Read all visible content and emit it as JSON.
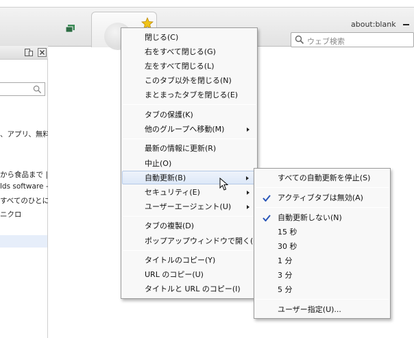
{
  "window": {
    "title": "about:blank"
  },
  "search": {
    "placeholder": "ウェブ検索"
  },
  "panel": {
    "lines": [
      "、アプリ、無料の",
      "から食品まで |",
      "lds software -",
      "すべてのひとに。",
      "ニクロ"
    ]
  },
  "tab_menu": {
    "items": [
      {
        "label": "閉じる(C)",
        "submenu": false
      },
      {
        "label": "右をすべて閉じる(G)",
        "submenu": false
      },
      {
        "label": "左をすべて閉じる(L)",
        "submenu": false
      },
      {
        "label": "このタブ以外を閉じる(N)",
        "submenu": false
      },
      {
        "label": "まとまったタブを閉じる(E)",
        "submenu": false
      },
      {
        "label": "タブの保護(K)",
        "submenu": false
      },
      {
        "label": "他のグループへ移動(M)",
        "submenu": true
      },
      {
        "label": "最新の情報に更新(R)",
        "submenu": false
      },
      {
        "label": "中止(O)",
        "submenu": false
      },
      {
        "label": "自動更新(B)",
        "submenu": true,
        "highlighted": true
      },
      {
        "label": "セキュリティ(E)",
        "submenu": true
      },
      {
        "label": "ユーザーエージェント(U)",
        "submenu": true
      },
      {
        "label": "タブの複製(D)",
        "submenu": false
      },
      {
        "label": "ポップアップウィンドウで開く(S)",
        "submenu": false
      },
      {
        "label": "タイトルのコピー(Y)",
        "submenu": false
      },
      {
        "label": "URL のコピー(U)",
        "submenu": false
      },
      {
        "label": "タイトルと URL のコピー(I)",
        "submenu": false
      }
    ]
  },
  "auto_reload_menu": {
    "items": [
      {
        "label": "すべての自動更新を停止(S)",
        "checked": false
      },
      {
        "label": "アクティブタブは無効(A)",
        "checked": true
      },
      {
        "label": "自動更新しない(N)",
        "checked": true
      },
      {
        "label": "15 秒",
        "checked": false
      },
      {
        "label": "30 秒",
        "checked": false
      },
      {
        "label": "1 分",
        "checked": false
      },
      {
        "label": "3 分",
        "checked": false
      },
      {
        "label": "5 分",
        "checked": false
      },
      {
        "label": "ユーザー指定(U)...",
        "checked": false
      }
    ]
  },
  "colors": {
    "accent_check": "#2a56b8",
    "highlight": "#dde8f8"
  }
}
